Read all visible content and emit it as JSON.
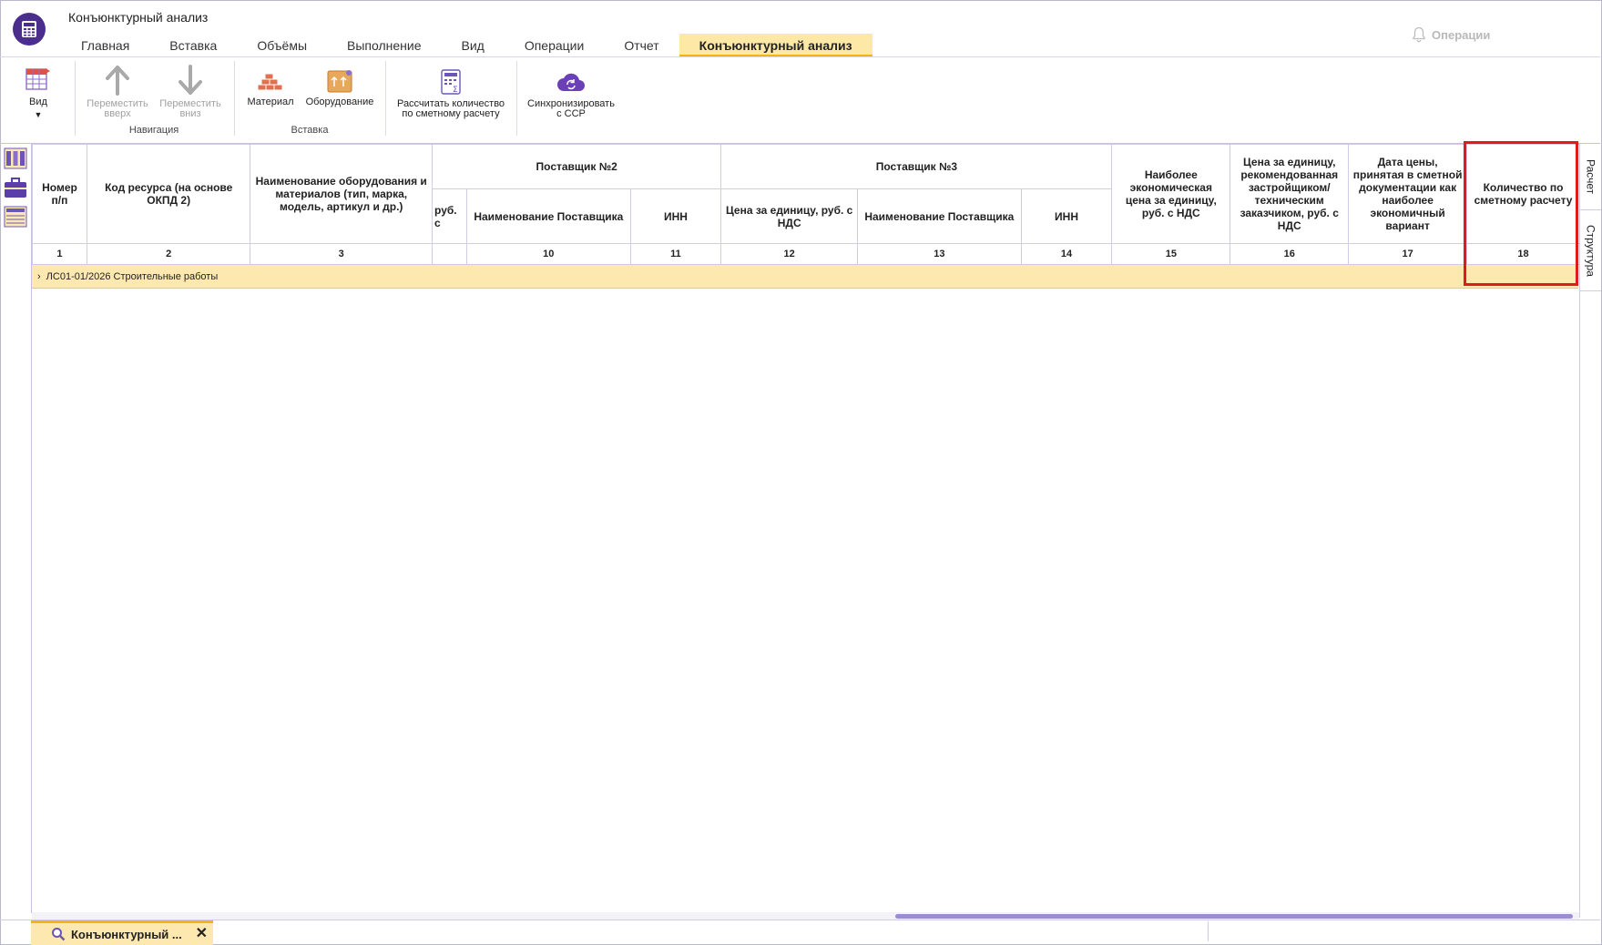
{
  "app": {
    "title": "Конъюнктурный анализ"
  },
  "tabs": [
    {
      "label": "Главная",
      "active": false
    },
    {
      "label": "Вставка",
      "active": false
    },
    {
      "label": "Объёмы",
      "active": false
    },
    {
      "label": "Выполнение",
      "active": false
    },
    {
      "label": "Вид",
      "active": false
    },
    {
      "label": "Операции",
      "active": false
    },
    {
      "label": "Отчет",
      "active": false
    },
    {
      "label": "Конъюнктурный анализ",
      "active": true
    }
  ],
  "operations": {
    "label": "Операции",
    "icon": "bell-icon"
  },
  "ribbon": {
    "view": {
      "label": "Вид"
    },
    "move_up": {
      "line1": "Переместить",
      "line2": "вверх"
    },
    "move_down": {
      "line1": "Переместить",
      "line2": "вниз"
    },
    "nav_group": "Навигация",
    "material": {
      "label": "Материал"
    },
    "equipment": {
      "label": "Оборудование"
    },
    "insert_group": "Вставка",
    "calc_qty": {
      "line1": "Рассчитать количество",
      "line2": "по сметному расчету"
    },
    "sync": {
      "line1": "Синхронизировать",
      "line2": "с ССР"
    }
  },
  "grid": {
    "headers": {
      "col1": "Номер п/п",
      "col2": "Код ресурса (на основе ОКПД 2)",
      "col3": "Наименование оборудования и материалов (тип, марка, модель, артикул и др.)",
      "supplier2": "Поставщик №2",
      "supplier3": "Поставщик №3",
      "col9_partial": "руб. с",
      "col10": "Наименование Поставщика",
      "col11": "ИНН",
      "col12": "Цена за единицу, руб. с НДС",
      "col13": "Наименование Поставщика",
      "col14": "ИНН",
      "col15": "Наиболее экономическая цена за единицу, руб. с НДС",
      "col16": "Цена за единицу, рекомендованная застройщиком/ техническим заказчиком, руб. с НДС",
      "col17": "Дата цены, принятая в сметной документации как наиболее экономичный вариант",
      "col18": "Количество по сметному расчету"
    },
    "numbers": {
      "n1": "1",
      "n2": "2",
      "n3": "3",
      "n10": "10",
      "n11": "11",
      "n12": "12",
      "n13": "13",
      "n14": "14",
      "n15": "15",
      "n16": "16",
      "n17": "17",
      "n18": "18"
    },
    "group_row": "ЛС01-01/2026 Строительные работы"
  },
  "side_tabs": {
    "calc": "Расчет",
    "structure": "Структура"
  },
  "bottom_tab": {
    "label": "Конъюнктурный ...",
    "close": "✕"
  },
  "colors": {
    "accent": "#f3b317",
    "active_tab_bg": "#fde8a6",
    "brand": "#4a2d8c",
    "highlight": "#e01b1b"
  }
}
